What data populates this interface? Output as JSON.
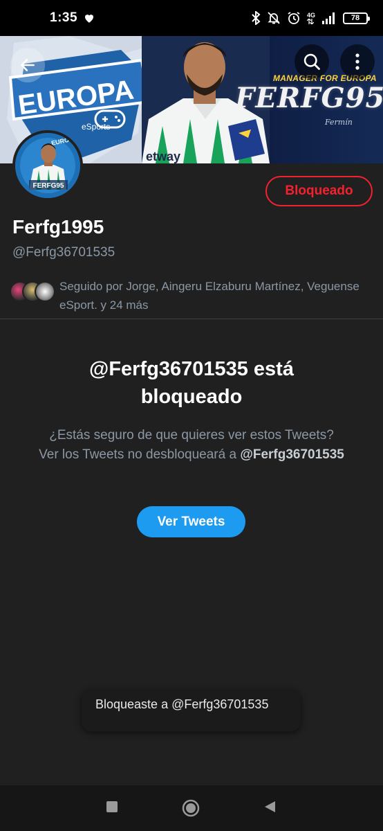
{
  "status_bar": {
    "time": "1:35",
    "network": "4G",
    "battery": "78",
    "icons": [
      "heart-icon",
      "bluetooth-icon",
      "mute-bell-icon",
      "alarm-icon",
      "signal-icon",
      "battery-icon"
    ]
  },
  "banner": {
    "shield_text": "EUROPA",
    "shield_subtext": "eSports",
    "tagline": "MANAGER FOR EUROPA",
    "brand": "FERFG95",
    "signature": "Fermín",
    "sponsor_text": "etway",
    "colors": {
      "gold": "#ffd23a",
      "navy": "#0f1e44"
    }
  },
  "avatar": {
    "label": "FERFG95",
    "top_text": "EUROPA"
  },
  "profile": {
    "display_name": "Ferfg1995",
    "handle": "@Ferfg36701535",
    "blocked_label": "Bloqueado",
    "followed_by": "Seguido por Jorge, Aingeru Elzaburu Martínez, Veguense eSport. y 24 más"
  },
  "blocked_notice": {
    "title": "@Ferfg36701535 está bloqueado",
    "message": "¿Estás seguro de que quieres ver estos Tweets? Ver los Tweets no desbloqueará a",
    "handle": "@Ferfg36701535",
    "view_button": "Ver Tweets"
  },
  "toast": {
    "text": "Bloqueaste a @Ferfg36701535"
  },
  "colors": {
    "accent": "#1d9bf0",
    "danger": "#f4212e",
    "background": "#202020"
  }
}
